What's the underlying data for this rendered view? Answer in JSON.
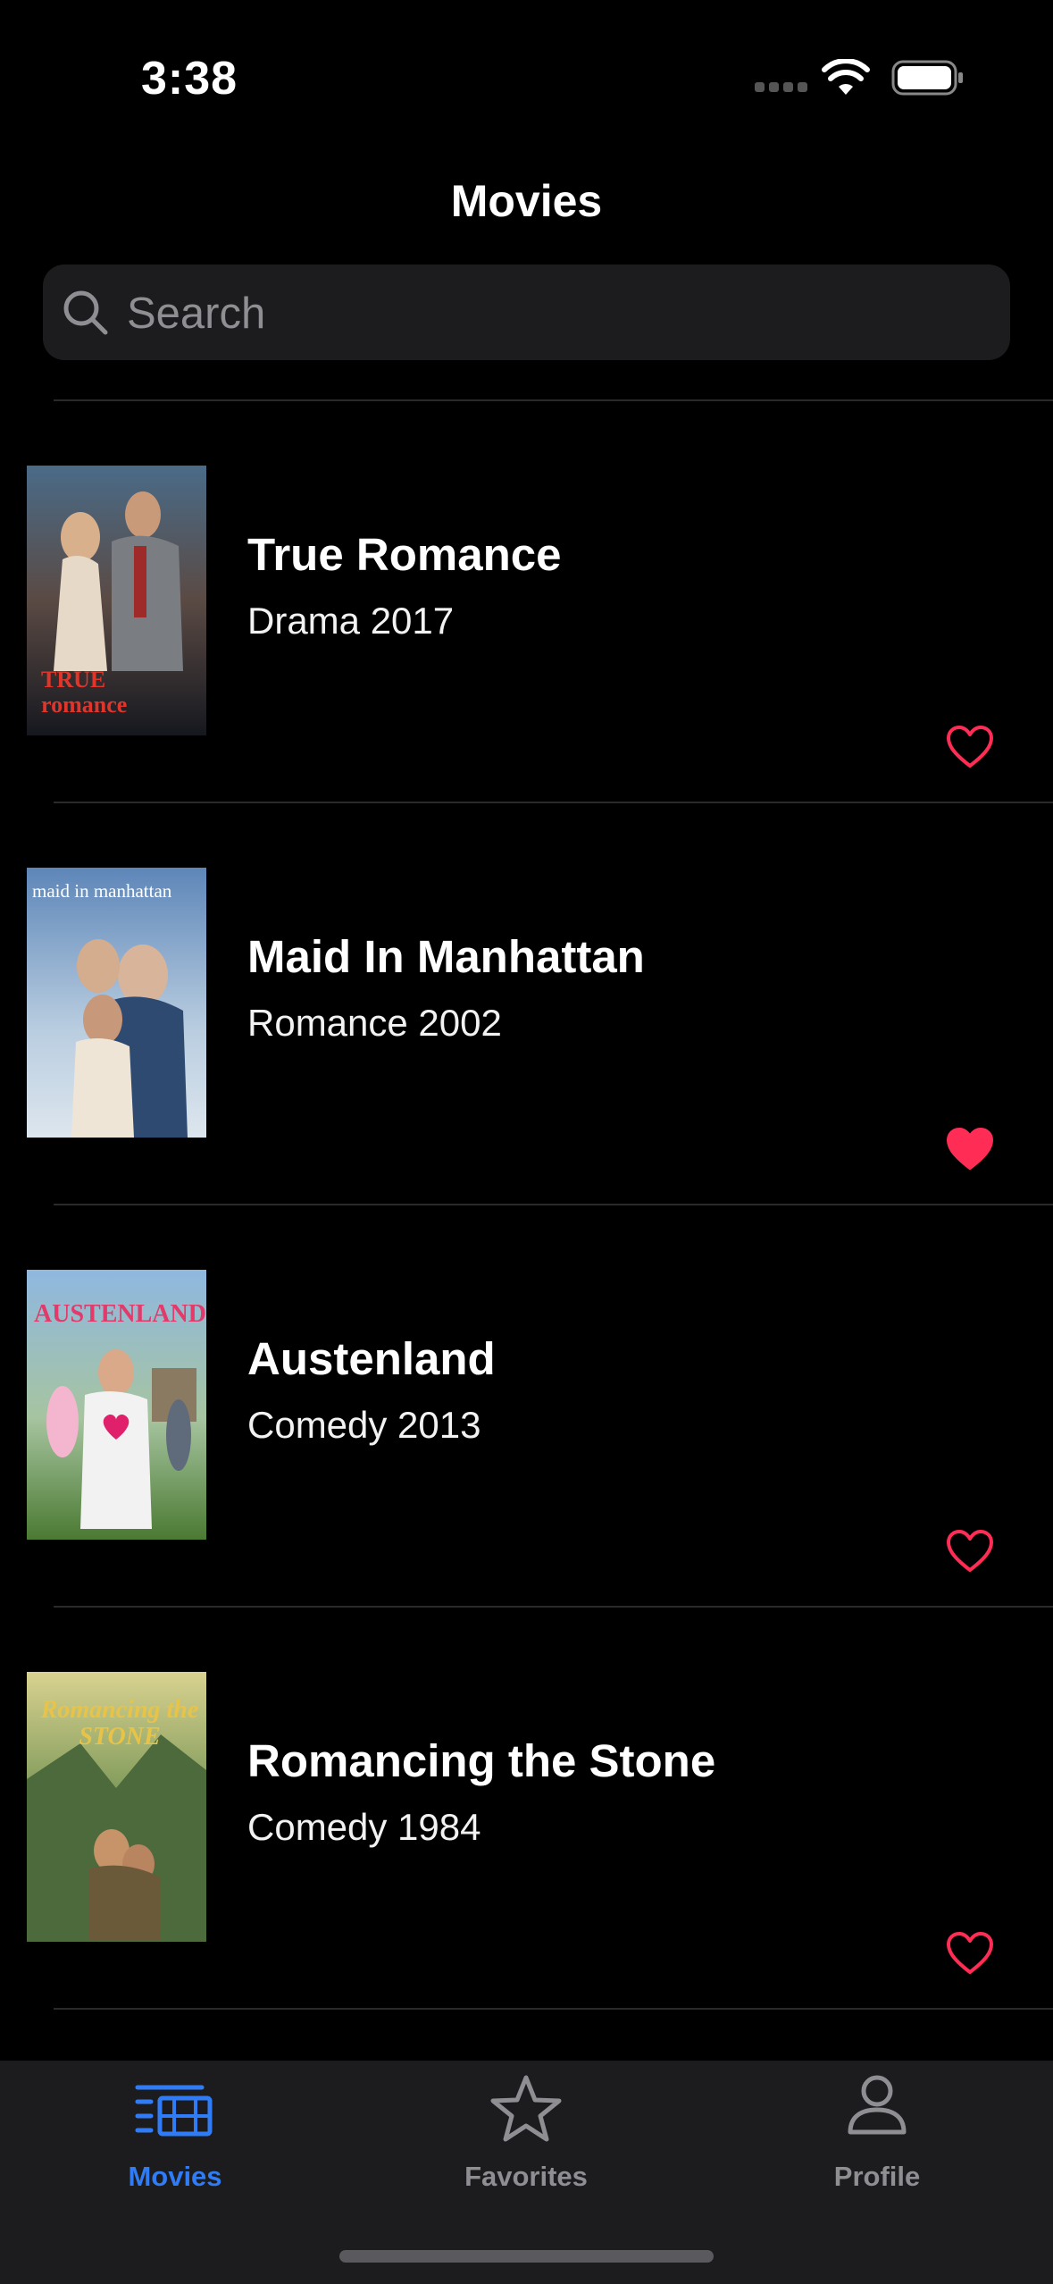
{
  "status": {
    "time": "3:38"
  },
  "nav": {
    "title": "Movies"
  },
  "search": {
    "placeholder": "Search"
  },
  "movies": [
    {
      "title": "True Romance",
      "subtitle": "Drama 2017",
      "favorite": false,
      "poster_text": "TRUE romance"
    },
    {
      "title": "Maid In Manhattan",
      "subtitle": "Romance 2002",
      "favorite": true,
      "poster_text": "maid in manhattan"
    },
    {
      "title": "Austenland",
      "subtitle": "Comedy 2013",
      "favorite": false,
      "poster_text": "AUSTENLAND"
    },
    {
      "title": "Romancing the Stone",
      "subtitle": "Comedy 1984",
      "favorite": false,
      "poster_text": "Romancing the STONE"
    }
  ],
  "tabs": [
    {
      "label": "Movies",
      "icon": "film-list-icon",
      "active": true
    },
    {
      "label": "Favorites",
      "icon": "star-icon",
      "active": false
    },
    {
      "label": "Profile",
      "icon": "person-icon",
      "active": false
    }
  ],
  "colors": {
    "accent": "#2f7cf6",
    "heart": "#ff2d55",
    "background": "#000000",
    "surface": "#1c1c1e"
  }
}
